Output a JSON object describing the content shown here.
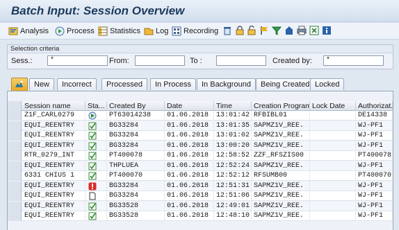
{
  "window": {
    "title": "Batch Input: Session Overview"
  },
  "toolbar": {
    "analysis_label": "Analysis",
    "process_label": "Process",
    "statistics_label": "Statistics",
    "log_label": "Log",
    "recording_label": "Recording",
    "icons": [
      "delete-icon",
      "lock-icon",
      "unlock-icon",
      "flag-icon",
      "filter-icon",
      "export-icon",
      "print-icon",
      "spreadsheet-icon",
      "info-icon"
    ]
  },
  "criteria": {
    "heading": "Selection criteria",
    "session_label": "Sess.:",
    "session_value": "*",
    "from_label": "From:",
    "from_value": "",
    "to_label": "To :",
    "to_value": "",
    "created_by_label": "Created by:",
    "created_by_value": "*"
  },
  "tabs": [
    "New",
    "Incorrect",
    "Processed",
    "In Process",
    "In Background",
    "Being Created",
    "Locked"
  ],
  "table": {
    "columns": [
      "Session name",
      "Sta...",
      "Created By",
      "Date",
      "Time",
      "Creation Program",
      "Lock Date",
      "Authorizat."
    ],
    "rows": [
      {
        "session": "Z1F_CARL0279",
        "status": "processing",
        "created_by": "PT63014238",
        "date": "01.06.2018",
        "time": "13:01:42",
        "program": "RFBIBL01",
        "lock_date": "",
        "auth": "DE14338"
      },
      {
        "session": "EQUI_REENTRY",
        "status": "processed",
        "created_by": "BG33284",
        "date": "01.06.2018",
        "time": "13:01:35",
        "program": "SAPMZ1V_REE.",
        "lock_date": "",
        "auth": "WJ-PF1"
      },
      {
        "session": "EQUI_REENTRY",
        "status": "processed",
        "created_by": "BG33284",
        "date": "01.06.2018",
        "time": "13:01:02",
        "program": "SAPMZ1V_REE.",
        "lock_date": "",
        "auth": "WJ-PF1"
      },
      {
        "session": "EQUI_REENTRY",
        "status": "processed",
        "created_by": "BG33284",
        "date": "01.06.2018",
        "time": "13:00:20",
        "program": "SAPMZ1V_REE.",
        "lock_date": "",
        "auth": "WJ-PF1"
      },
      {
        "session": "RTR_0279_INT",
        "status": "processed",
        "created_by": "PT400078",
        "date": "01.06.2018",
        "time": "12:58:52",
        "program": "ZZF_RFSZIS00",
        "lock_date": "",
        "auth": "PT400078"
      },
      {
        "session": "EQUI_REENTRY",
        "status": "processed",
        "created_by": "THPLUEA",
        "date": "01.06.2018",
        "time": "12:52:24",
        "program": "SAPMZ1V_REE.",
        "lock_date": "",
        "auth": "WJ-PF1"
      },
      {
        "session": "6331 CHIUS 1",
        "status": "processed",
        "created_by": "PT400070",
        "date": "01.06.2018",
        "time": "12:52:12",
        "program": "RFSUMB00",
        "lock_date": "",
        "auth": "PT400070"
      },
      {
        "session": "EQUI_REENTRY",
        "status": "error",
        "created_by": "BG33284",
        "date": "01.06.2018",
        "time": "12:51:31",
        "program": "SAPMZ1V_REE.",
        "lock_date": "",
        "auth": "WJ-PF1"
      },
      {
        "session": "EQUI_REENTRY",
        "status": "new",
        "created_by": "BG33284",
        "date": "01.06.2018",
        "time": "12:51:06",
        "program": "SAPMZ1V_REE.",
        "lock_date": "",
        "auth": "WJ-PF1"
      },
      {
        "session": "EQUI_REENTRY",
        "status": "processed",
        "created_by": "BG33528",
        "date": "01.06.2018",
        "time": "12:49:01",
        "program": "SAPMZ1V_REE.",
        "lock_date": "",
        "auth": "WJ-PF1"
      },
      {
        "session": "EQUI_REENTRY",
        "status": "processed",
        "created_by": "BG33528",
        "date": "01.06.2018",
        "time": "12:48:10",
        "program": "SAPMZ1V_REE.",
        "lock_date": "",
        "auth": "WJ-PF1"
      }
    ]
  }
}
